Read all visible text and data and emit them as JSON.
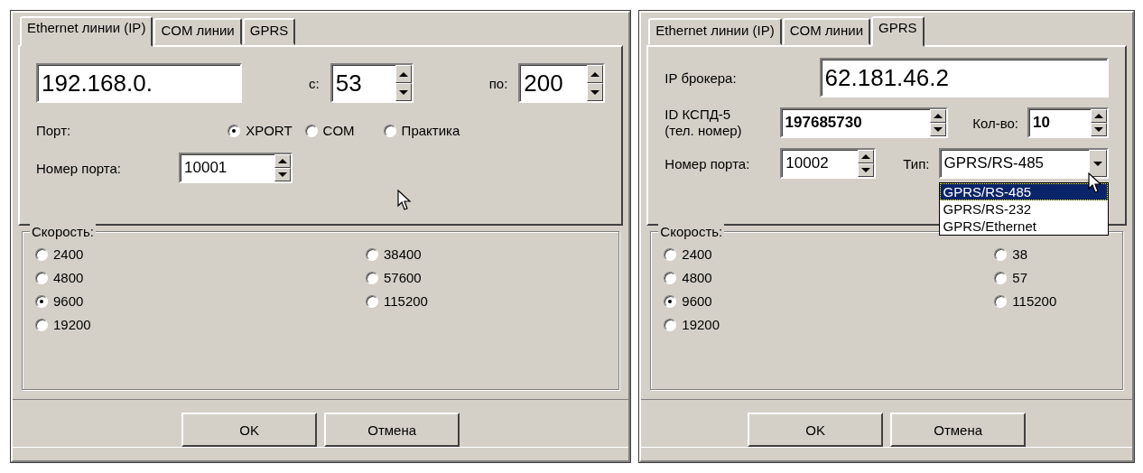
{
  "dialogs": [
    {
      "kind": "ethernet",
      "tabs": [
        {
          "label": "Ethernet линии (IP)",
          "selected": true
        },
        {
          "label": "COM линии",
          "selected": false
        },
        {
          "label": "GPRS",
          "selected": false
        }
      ],
      "ip_prefix": "192.168.0.",
      "from_label": "с:",
      "from_value": "53",
      "to_label": "по:",
      "to_value": "200",
      "port_label": "Порт:",
      "port_options": [
        {
          "label": "XPORT",
          "selected": true
        },
        {
          "label": "COM",
          "selected": false
        },
        {
          "label": "Практика",
          "selected": false
        }
      ],
      "port_number_label": "Номер порта:",
      "port_number": "10001",
      "speed": {
        "title": "Скорость:",
        "options": [
          {
            "label": "2400",
            "selected": false
          },
          {
            "label": "4800",
            "selected": false
          },
          {
            "label": "9600",
            "selected": true
          },
          {
            "label": "19200",
            "selected": false
          },
          {
            "label": "38400",
            "selected": false
          },
          {
            "label": "57600",
            "selected": false
          },
          {
            "label": "115200",
            "selected": false
          }
        ]
      },
      "buttons": [
        "OK",
        "Отмена"
      ]
    },
    {
      "kind": "gprs",
      "tabs": [
        {
          "label": "Ethernet линии (IP)",
          "selected": false
        },
        {
          "label": "COM линии",
          "selected": false
        },
        {
          "label": "GPRS",
          "selected": true
        }
      ],
      "broker_label": "IP брокера:",
      "broker_ip": "62.181.46.2",
      "id_label": [
        "ID КСПД-5",
        "(тел. номер)"
      ],
      "id_value": "197685730",
      "count_label": "Кол-во:",
      "count_value": "10",
      "port_number_label": "Номер порта:",
      "port_number": "10002",
      "type_label": "Тип:",
      "type_value": "GPRS/RS-485",
      "type_dropdown": [
        {
          "label": "GPRS/RS-485",
          "selected": true
        },
        {
          "label": "GPRS/RS-232",
          "selected": false
        },
        {
          "label": "GPRS/Ethernet",
          "selected": false
        }
      ],
      "speed": {
        "title": "Скорость:",
        "options": [
          {
            "label": "2400",
            "selected": false
          },
          {
            "label": "4800",
            "selected": false
          },
          {
            "label": "9600",
            "selected": true
          },
          {
            "label": "19200",
            "selected": false
          },
          {
            "label": "38",
            "selected": false
          },
          {
            "label": "57",
            "selected": false
          },
          {
            "label": "115200",
            "selected": false
          }
        ]
      },
      "buttons": [
        "OK",
        "Отмена"
      ]
    }
  ]
}
